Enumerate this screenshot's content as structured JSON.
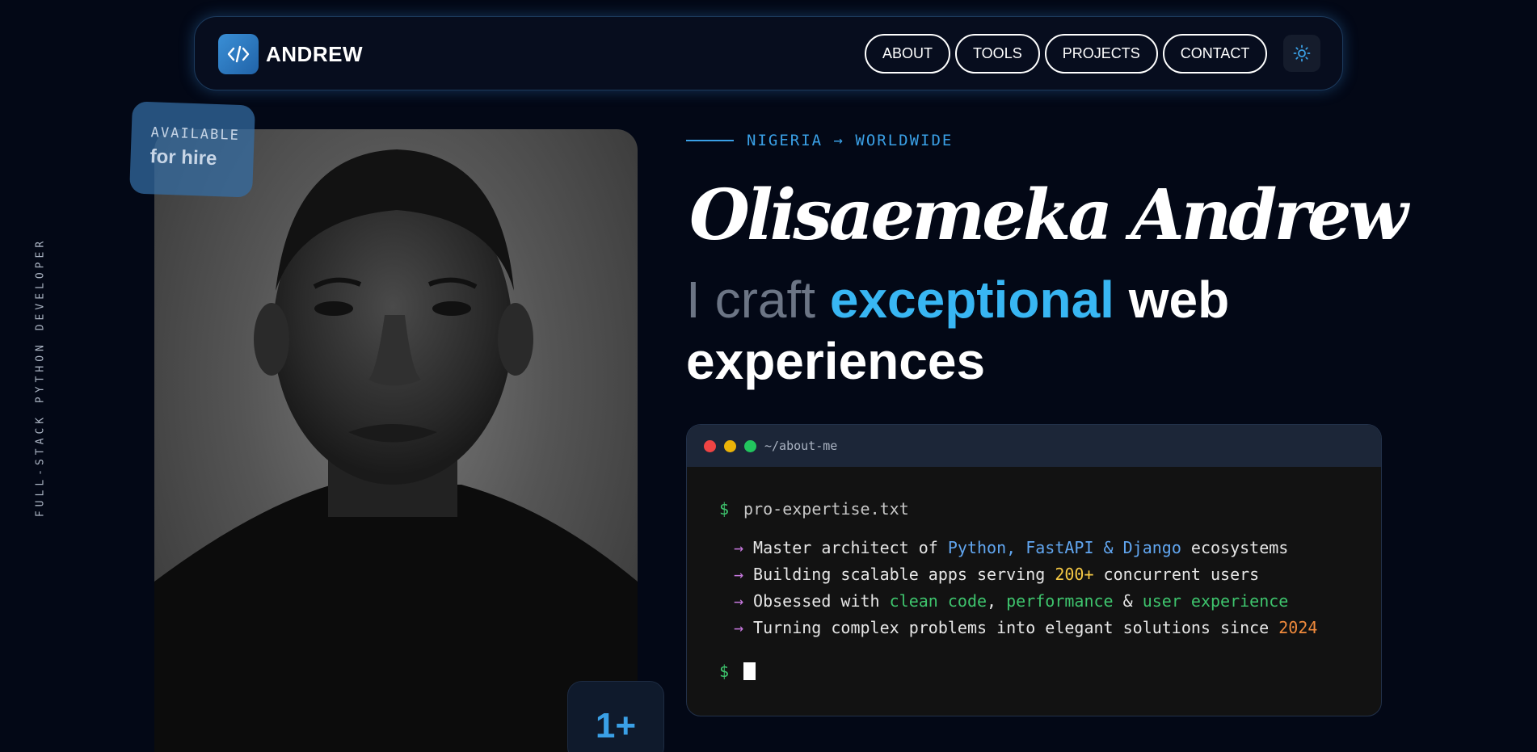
{
  "nav": {
    "brand": "ANDREW",
    "links": [
      "ABOUT",
      "TOOLS",
      "PROJECTS",
      "CONTACT"
    ]
  },
  "side_label": "FULL-STACK PYTHON DEVELOPER",
  "badge": {
    "top": "AVAILABLE",
    "bottom": "for hire"
  },
  "years_card": {
    "value": "1+"
  },
  "hero": {
    "location": "NIGERIA → WORLDWIDE",
    "name": "Olisaemeka Andrew",
    "tagline_muted": "I craft",
    "tagline_accent": "exceptional",
    "tagline_rest": "web experiences"
  },
  "terminal": {
    "title": "~/about-me",
    "prompt": "$",
    "command": "pro-expertise.txt",
    "arrow": "→",
    "line1": {
      "a": "Master architect of ",
      "b": "Python, FastAPI & Django",
      "c": " ecosystems"
    },
    "line2": {
      "a": "Building scalable apps serving ",
      "b": "200+",
      "c": " concurrent users"
    },
    "line3": {
      "a": "Obsessed with ",
      "b": "clean code",
      "c": ", ",
      "d": "performance",
      "e": " & ",
      "f": "user experience"
    },
    "line4": {
      "a": "Turning complex problems into elegant solutions since ",
      "b": "2024"
    }
  },
  "colors": {
    "accent": "#38b6f3",
    "background": "#030816"
  },
  "icons": {
    "brand": "code-brackets-icon",
    "theme": "sun-icon"
  }
}
